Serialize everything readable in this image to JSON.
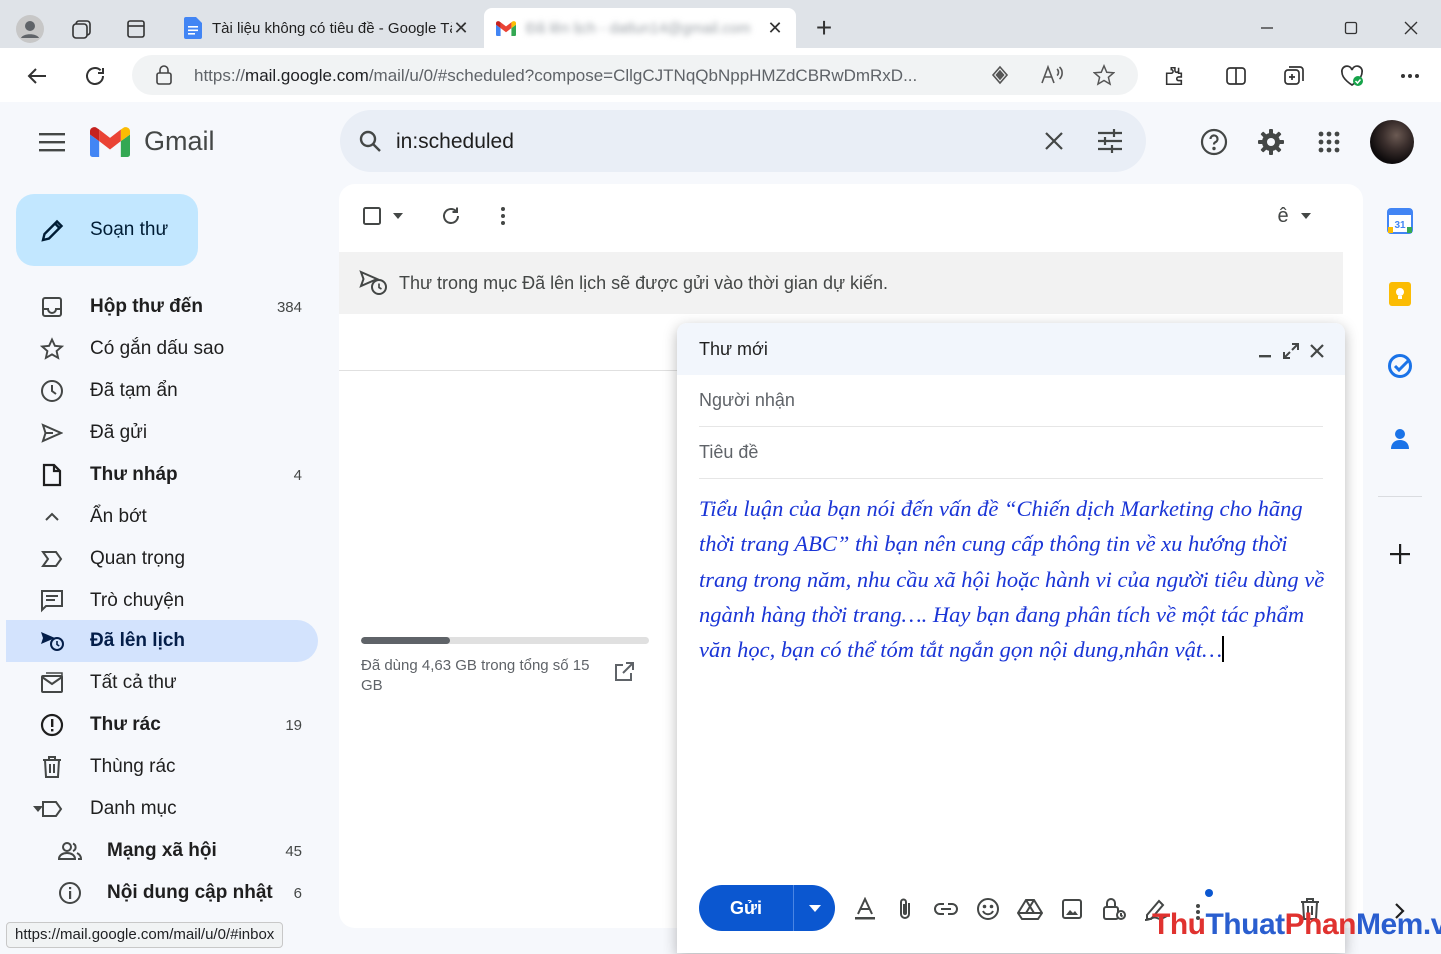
{
  "browser": {
    "tabs": [
      {
        "title": "Tài liệu không có tiêu đề - Google Tài liệu",
        "active": false
      },
      {
        "title": "Đã lên lịch - datlun14@gmail.com",
        "active": true
      }
    ],
    "new_tab": "+",
    "url_prefix": "https://",
    "url_host": "mail.google.com",
    "url_path": "/mail/u/0/#scheduled?compose=CllgCJTNqQbNppHMZdCBRwDmRxD..."
  },
  "gmail": {
    "wordmark": "Gmail",
    "search_query": "in:scheduled",
    "compose_label": "Soạn thư",
    "nav": [
      {
        "label": "Hộp thư đến",
        "count": "384",
        "bold": true,
        "icon": "inbox-icon"
      },
      {
        "label": "Có gắn dấu sao",
        "count": "",
        "bold": false,
        "icon": "star-icon"
      },
      {
        "label": "Đã tạm ẩn",
        "count": "",
        "bold": false,
        "icon": "clock-icon"
      },
      {
        "label": "Đã gửi",
        "count": "",
        "bold": false,
        "icon": "send-icon"
      },
      {
        "label": "Thư nháp",
        "count": "4",
        "bold": true,
        "icon": "draft-icon"
      },
      {
        "label": "Ẩn bớt",
        "count": "",
        "bold": false,
        "icon": "chevron-up-icon"
      },
      {
        "label": "Quan trọng",
        "count": "",
        "bold": false,
        "icon": "important-icon"
      },
      {
        "label": "Trò chuyện",
        "count": "",
        "bold": false,
        "icon": "chat-icon"
      },
      {
        "label": "Đã lên lịch",
        "count": "",
        "bold": true,
        "icon": "scheduled-icon",
        "active": true
      },
      {
        "label": "Tất cả thư",
        "count": "",
        "bold": false,
        "icon": "all-mail-icon"
      },
      {
        "label": "Thư rác",
        "count": "19",
        "bold": true,
        "icon": "spam-icon"
      },
      {
        "label": "Thùng rác",
        "count": "",
        "bold": false,
        "icon": "trash-icon"
      },
      {
        "label": "Danh mục",
        "count": "",
        "bold": false,
        "icon": "label-icon"
      },
      {
        "label": "Mạng xã hội",
        "count": "45",
        "bold": true,
        "icon": "social-icon",
        "sub": true
      },
      {
        "label": "Nội dung cập nhật",
        "count": "6",
        "bold": true,
        "icon": "info-icon",
        "sub": true
      }
    ],
    "banner": "Thư trong mục Đã lên lịch sẽ được gửi vào thời gian dự kiến.",
    "toolbar_lang": "ê",
    "storage": {
      "text": "Đã dùng 4,63 GB trong tổng số 15 GB",
      "used_fraction": 0.31
    }
  },
  "compose": {
    "title": "Thư mới",
    "to_placeholder": "Người nhận",
    "subject_placeholder": "Tiêu đề",
    "body": "Tiểu luận của bạn nói đến vấn đề “Chiến dịch Marketing cho hãng thời trang ABC” thì bạn nên cung cấp thông tin về xu hướng thời trang trong năm, nhu cầu xã hội hoặc hành vi của người tiêu dùng về ngành hàng thời trang…. Hay bạn đang phân tích về một tác phẩm văn học, bạn có thể tóm tắt ngắn gọn nội dung,nhân vật…",
    "send_label": "Gửi"
  },
  "side_panel": {
    "calendar_day": "31"
  },
  "status_url": "https://mail.google.com/mail/u/0/#inbox",
  "watermark": {
    "p1": "Thu",
    "p2": "Thuat",
    "p3": "Phan",
    "p4": "Mem",
    "p5": ".vn"
  },
  "colors": {
    "accent": "#0b57d0",
    "compose_button": "#c2e7ff",
    "active_nav": "#d3e3fd",
    "body_text": "#1a35d6"
  }
}
